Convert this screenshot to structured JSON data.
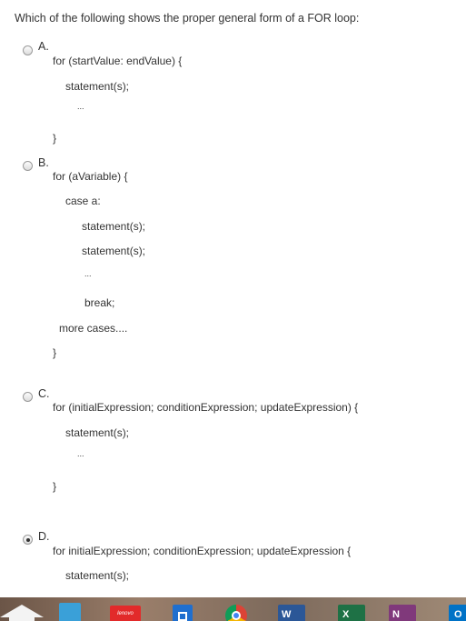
{
  "question": "Which of the following shows the proper general form of a FOR loop:",
  "options": [
    {
      "letter": "A.",
      "checked": false,
      "lines": [
        "for (startValue: endValue) {",
        "statement(s);",
        "...",
        "}"
      ]
    },
    {
      "letter": "B.",
      "checked": false,
      "lines": [
        "for (aVariable) {",
        "case a:",
        "statement(s);",
        "statement(s);",
        "...",
        "break;",
        "more cases....",
        "}"
      ]
    },
    {
      "letter": "C.",
      "checked": false,
      "lines": [
        "for (initialExpression; conditionExpression; updateExpression) {",
        "statement(s);",
        "...",
        "}"
      ]
    },
    {
      "letter": "D.",
      "checked": true,
      "lines": [
        "for initialExpression; conditionExpression; updateExpression {",
        "statement(s);"
      ]
    }
  ],
  "taskbar": {
    "icons": [
      "home-icon",
      "shopping-cart-icon",
      "lenovo-icon",
      "square-app-icon",
      "chrome-icon",
      "word-icon",
      "excel-icon",
      "onenote-icon",
      "outlook-icon"
    ],
    "lenovo_label": "lenovo",
    "word_label": "W",
    "excel_label": "X",
    "onenote_label": "N",
    "outlook_label": "O"
  }
}
